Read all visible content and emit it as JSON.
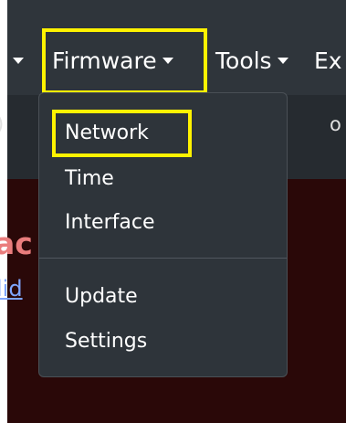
{
  "navbar": {
    "items": [
      {
        "label": "Firmware",
        "highlighted": true
      },
      {
        "label": "Tools"
      },
      {
        "label": "Ex"
      }
    ]
  },
  "strip": {
    "left_text": ")",
    "right_text": "o"
  },
  "content": {
    "heading_partial": "ac",
    "link_partial": "lid"
  },
  "dropdown": {
    "items": [
      {
        "label": "Network",
        "highlighted": true
      },
      {
        "label": "Time"
      },
      {
        "label": "Interface"
      },
      {
        "label": "Update"
      },
      {
        "label": "Settings"
      }
    ]
  },
  "colors": {
    "navbar_bg": "#2f353b",
    "dropdown_bg": "#2e343a",
    "content_bg": "#2a0808",
    "highlight": "#fff200",
    "heading": "#ea7d7d",
    "link": "#7fa6ff"
  }
}
